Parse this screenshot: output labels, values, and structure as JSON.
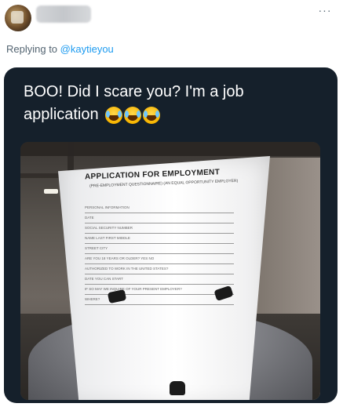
{
  "header": {
    "more_icon": "more-horizontal-icon",
    "more_glyph": "···"
  },
  "reply": {
    "prefix": "Replying to ",
    "handle": "@kaytieyou"
  },
  "quoted": {
    "text": "BOO! Did I scare you?  I'm a job application",
    "emoji_icon": "joy-emoji-icon",
    "emoji_count": 3
  },
  "photo": {
    "form_title": "APPLICATION FOR EMPLOYMENT",
    "form_subtitle": "(PRE-EMPLOYMENT QUESTIONNAIRE)        (AN EQUAL OPPORTUNITY EMPLOYER)",
    "form_fields": [
      "PERSONAL INFORMATION",
      "DATE",
      "SOCIAL SECURITY NUMBER",
      "NAME   LAST   FIRST   MIDDLE",
      "STREET   CITY",
      "ARE YOU 18 YEARS OR OLDER?   YES   NO",
      "AUTHORIZED TO WORK IN THE UNITED STATES?",
      "DATE YOU CAN START",
      "IF SO MAY WE INQUIRE OF YOUR PRESENT EMPLOYER?",
      "WHERE?"
    ]
  },
  "colors": {
    "card_bg": "#15202b",
    "link": "#1d9bf0",
    "muted": "#536471"
  }
}
